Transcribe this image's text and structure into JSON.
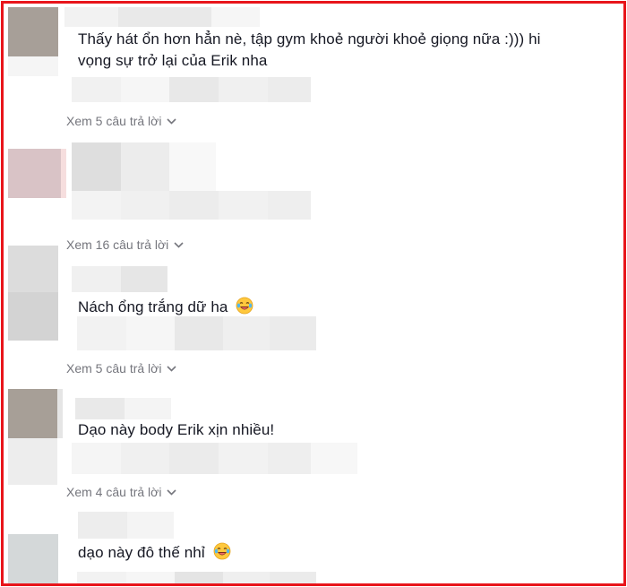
{
  "comments": [
    {
      "text_line1": "Thấy hát ổn hơn hẳn nè, tập gym khoẻ người khoẻ giọng nữa :))) hi",
      "text_line2": "vọng sự trở lại của Erik nha",
      "replies_label": "Xem 5 câu trả lời"
    },
    {
      "text": "",
      "replies_label": "Xem 16 câu trả lời"
    },
    {
      "text": "Nách ổng trắng dữ ha",
      "emoji": "laughing-tears-emoji",
      "replies_label": "Xem 5 câu trả lời"
    },
    {
      "text": "Dạo này body Erik xịn nhiều!",
      "replies_label": "Xem 4 câu trả lời"
    },
    {
      "text": "dạo này đô thế nhỉ",
      "emoji": "laughing-tears-emoji"
    }
  ],
  "icons": {
    "expand": "chevron-down-icon"
  },
  "colors": {
    "frame_border": "#e8151b",
    "text": "#161823",
    "muted": "#75767d",
    "pixelated_gray": "#eeeeee"
  }
}
